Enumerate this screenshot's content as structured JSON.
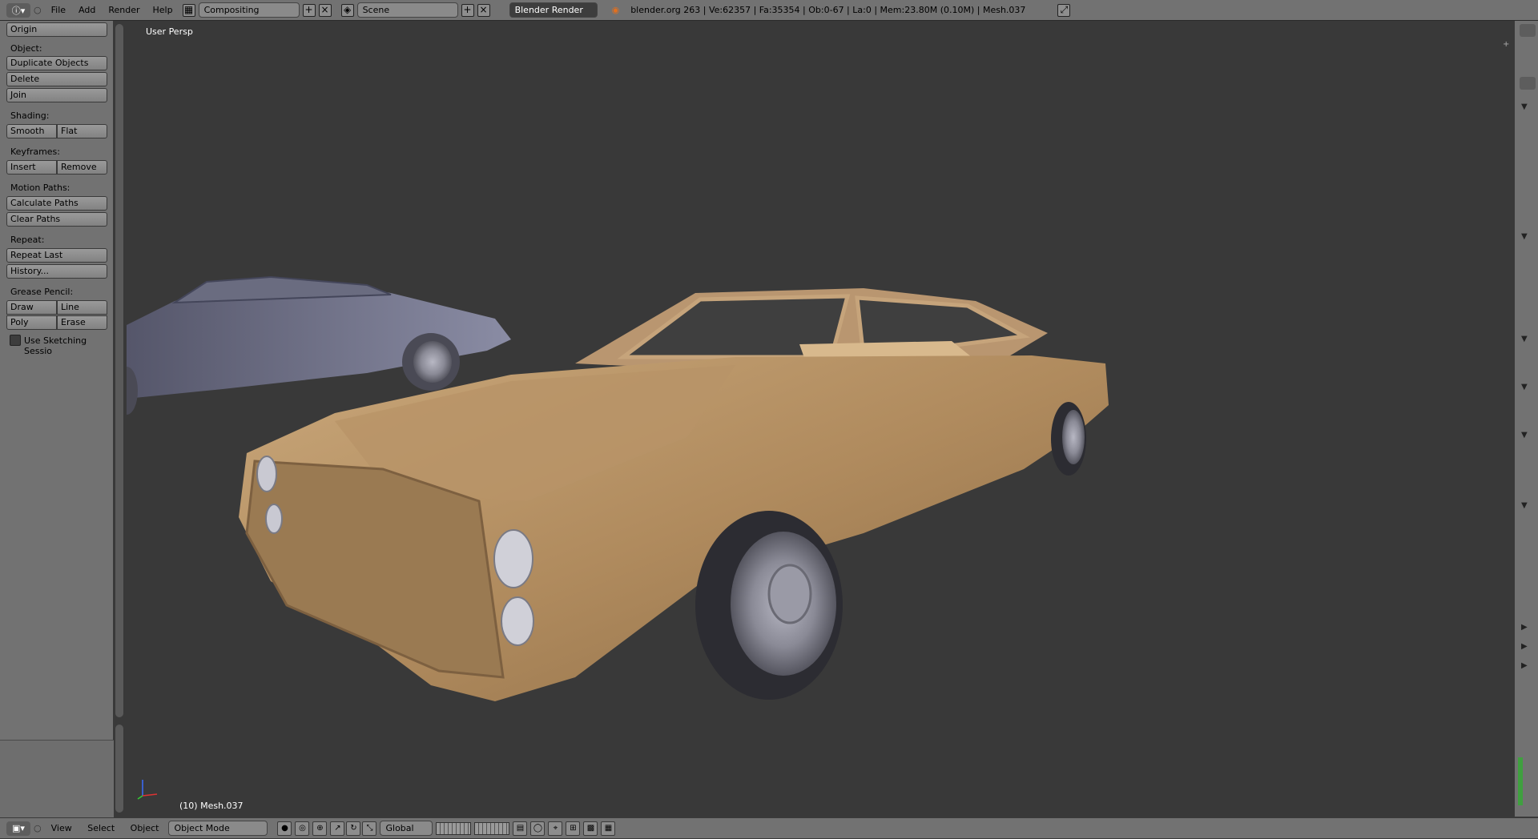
{
  "topbar": {
    "menus": [
      "File",
      "Add",
      "Render",
      "Help"
    ],
    "layout": "Compositing",
    "scene": "Scene",
    "engine": "Blender Render",
    "stats": "blender.org 263 | Ve:62357 | Fa:35354 | Ob:0-67 | La:0 | Mem:23.80M (0.10M) | Mesh.037"
  },
  "toolshelf": {
    "origin": "Origin",
    "object_label": "Object:",
    "duplicate": "Duplicate Objects",
    "delete": "Delete",
    "join": "Join",
    "shading_label": "Shading:",
    "smooth": "Smooth",
    "flat": "Flat",
    "keyframes_label": "Keyframes:",
    "insert": "Insert",
    "remove": "Remove",
    "motion_label": "Motion Paths:",
    "calc_paths": "Calculate Paths",
    "clear_paths": "Clear Paths",
    "repeat_label": "Repeat:",
    "repeat_last": "Repeat Last",
    "history": "History...",
    "grease_label": "Grease Pencil:",
    "draw": "Draw",
    "line": "Line",
    "poly": "Poly",
    "erase": "Erase",
    "sketch": "Use Sketching Sessio"
  },
  "viewport": {
    "persp": "User Persp",
    "object": "(10) Mesh.037"
  },
  "bottombar": {
    "menus": [
      "View",
      "Select",
      "Object"
    ],
    "mode": "Object Mode",
    "orientation": "Global"
  }
}
